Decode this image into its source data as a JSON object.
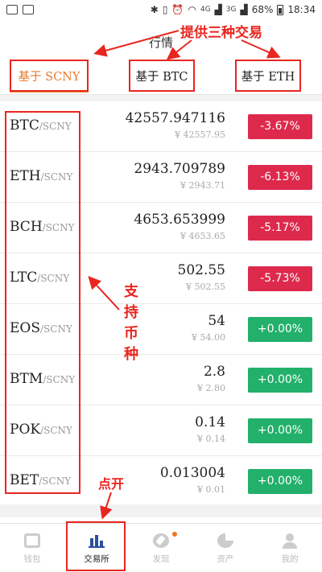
{
  "status_bar": {
    "network_mini_1": "4G",
    "network_mini_2": "3G",
    "battery": "68%",
    "time": "18:34"
  },
  "header": {
    "title": "行情",
    "tabs": [
      {
        "label": "基于 SCNY",
        "active": true
      },
      {
        "label": "基于 BTC",
        "active": false
      },
      {
        "label": "基于 ETH",
        "active": false
      }
    ]
  },
  "market_list": [
    {
      "symbol": "BTC",
      "quote": "/SCNY",
      "price": "42557.947116",
      "price_cny": "¥ 42557.95",
      "change": "-3.67%",
      "trend": "down"
    },
    {
      "symbol": "ETH",
      "quote": "/SCNY",
      "price": "2943.709789",
      "price_cny": "¥ 2943.71",
      "change": "-6.13%",
      "trend": "down"
    },
    {
      "symbol": "BCH",
      "quote": "/SCNY",
      "price": "4653.653999",
      "price_cny": "¥ 4653.65",
      "change": "-5.17%",
      "trend": "down"
    },
    {
      "symbol": "LTC",
      "quote": "/SCNY",
      "price": "502.55",
      "price_cny": "¥ 502.55",
      "change": "-5.73%",
      "trend": "down"
    },
    {
      "symbol": "EOS",
      "quote": "/SCNY",
      "price": "54",
      "price_cny": "¥ 54.00",
      "change": "+0.00%",
      "trend": "flat"
    },
    {
      "symbol": "BTM",
      "quote": "/SCNY",
      "price": "2.8",
      "price_cny": "¥ 2.80",
      "change": "+0.00%",
      "trend": "flat"
    },
    {
      "symbol": "POK",
      "quote": "/SCNY",
      "price": "0.14",
      "price_cny": "¥ 0.14",
      "change": "+0.00%",
      "trend": "flat"
    },
    {
      "symbol": "BET",
      "quote": "/SCNY",
      "price": "0.013004",
      "price_cny": "¥ 0.01",
      "change": "+0.00%",
      "trend": "flat"
    }
  ],
  "bottom_nav": [
    {
      "label": "钱包",
      "icon": "wallet-icon",
      "active": false
    },
    {
      "label": "交易所",
      "icon": "exchange-chart-icon",
      "active": true
    },
    {
      "label": "发现",
      "icon": "compass-icon",
      "active": false,
      "badge": true
    },
    {
      "label": "资产",
      "icon": "pie-icon",
      "active": false
    },
    {
      "label": "我的",
      "icon": "user-icon",
      "active": false
    }
  ],
  "annotations": {
    "tabs_note": "提供三种交易",
    "coins_note": "支持币种",
    "nav_note": "点开",
    "color": "#e8261f"
  },
  "colors": {
    "accent": "#f18a3b",
    "down": "#dd2a4c",
    "flat": "#22b06a"
  }
}
